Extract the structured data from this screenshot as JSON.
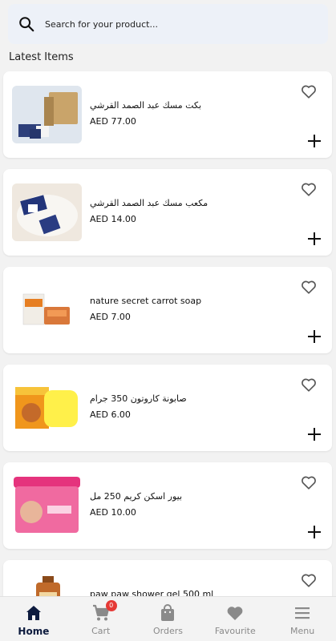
{
  "search": {
    "placeholder": "Search for your product..."
  },
  "section_title": "Latest Items",
  "items": [
    {
      "name": "بكت مسك عبد الصمد القرشي",
      "price": "AED 77.00",
      "image": "musk-box-set"
    },
    {
      "name": "مكعب مسك عبد الصمد القرشي",
      "price": "AED 14.00",
      "image": "musk-cubes"
    },
    {
      "name": "nature secret carrot soap",
      "price": "AED 7.00",
      "image": "carrot-soap"
    },
    {
      "name": "صابونة كاروتون 350 جرام",
      "price": "AED 6.00",
      "image": "carotone-soap"
    },
    {
      "name": "بيور اسكن كريم 250 مل",
      "price": "AED 10.00",
      "image": "pure-skin-cream"
    },
    {
      "name": "paw paw shower gel 500 ml",
      "price": "",
      "image": "shower-gel-bottle"
    }
  ],
  "nav": {
    "home": "Home",
    "cart": "Cart",
    "cart_count": "0",
    "orders": "Orders",
    "favourite": "Favourite",
    "menu": "Menu"
  },
  "colors": {
    "accent": "#0d1b3e",
    "badge": "#e53935",
    "search_bg": "#edf1f8",
    "page_bg": "#f2f2f2"
  }
}
